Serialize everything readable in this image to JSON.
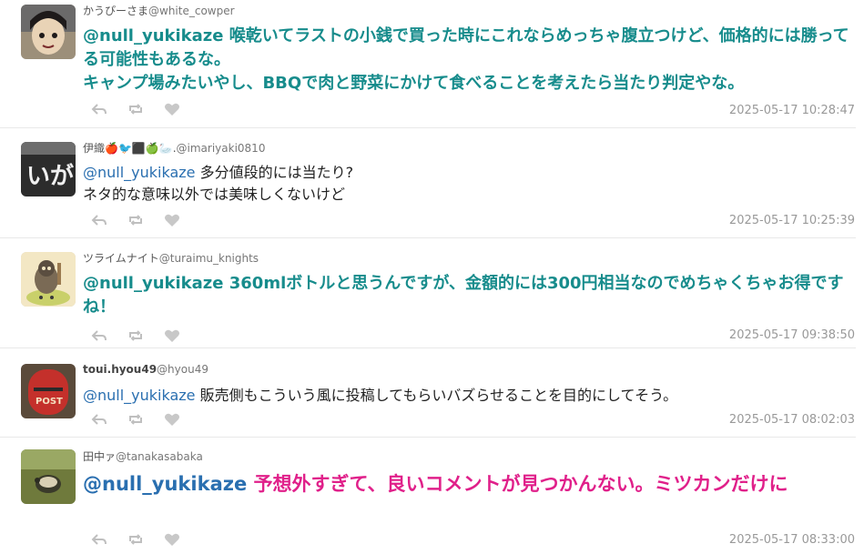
{
  "posts": [
    {
      "display_name": "かうぴーさま",
      "handle": "@white_cowper",
      "mention": "@null_yukikaze",
      "text": "喉乾いてラストの小銭で買った時にこれならめっちゃ腹立つけど、価格的には勝ってる可能性もあるな。\nキャンプ場みたいやし、BBQで肉と野菜にかけて食べることを考えたら当たり判定やな。",
      "timestamp": "2025-05-17 10:28:47"
    },
    {
      "display_name": "伊織🍎🐦⬛🍏🦢.",
      "handle": "@imariyaki0810",
      "mention": "@null_yukikaze",
      "text": "多分値段的には当たり?\nネタ的な意味以外では美味しくないけど",
      "timestamp": "2025-05-17 10:25:39"
    },
    {
      "display_name": "ツライムナイト",
      "handle": "@turaimu_knights",
      "mention": "@null_yukikaze",
      "text": "360mlボトルと思うんですが、金額的には300円相当なのでめちゃくちゃお得ですね！",
      "timestamp": "2025-05-17 09:38:50"
    },
    {
      "display_name": "toui.hyou49",
      "handle": "@hyou49",
      "mention": "@null_yukikaze",
      "text": "販売側もこういう風に投稿してもらいバズらせることを目的にしてそう。",
      "timestamp": "2025-05-17 08:02:03"
    },
    {
      "display_name": "田中ァ",
      "handle": "@tanakasabaka",
      "mention": "@null_yukikaze",
      "text": "予想外すぎて、良いコメントが見つかんない。ミツカンだけに",
      "timestamp": "2025-05-17 08:33:00"
    }
  ],
  "icons": [
    "reply-icon",
    "repost-icon",
    "like-icon"
  ],
  "colors": {
    "teal_text": "#178c8c",
    "mention_blue": "#2a6fb0",
    "pink_text": "#e0208a",
    "meta_gray": "#999999"
  }
}
